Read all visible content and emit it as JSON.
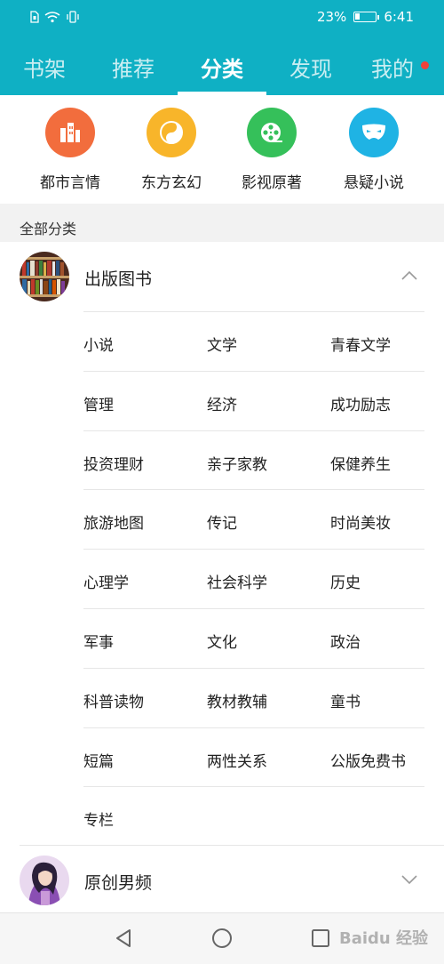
{
  "status_bar": {
    "battery_percent": "23%",
    "time": "6:41",
    "battery_level": 0.23,
    "icons": [
      "sim-icon",
      "wifi-icon",
      "vibrate-icon"
    ]
  },
  "tabs": [
    {
      "label": "书架"
    },
    {
      "label": "推荐"
    },
    {
      "label": "分类",
      "active": true
    },
    {
      "label": "发现"
    },
    {
      "label": "我的",
      "has_badge": true
    }
  ],
  "quick_categories": [
    {
      "label": "都市言情",
      "icon": "buildings-icon",
      "color": "#f26d3d"
    },
    {
      "label": "东方玄幻",
      "icon": "yin-yang-icon",
      "color": "#f8b52a"
    },
    {
      "label": "影视原著",
      "icon": "film-reel-icon",
      "color": "#35c05a"
    },
    {
      "label": "悬疑小说",
      "icon": "mask-icon",
      "color": "#1fb3e4"
    }
  ],
  "all_categories_label": "全部分类",
  "groups": [
    {
      "title": "出版图书",
      "expanded": true,
      "avatar": "bookshelf-image"
    },
    {
      "title": "原创男频",
      "expanded": false,
      "avatar": "character-image"
    }
  ],
  "subcategories": [
    [
      "小说",
      "文学",
      "青春文学"
    ],
    [
      "管理",
      "经济",
      "成功励志"
    ],
    [
      "投资理财",
      "亲子家教",
      "保健养生"
    ],
    [
      "旅游地图",
      "传记",
      "时尚美妆"
    ],
    [
      "心理学",
      "社会科学",
      "历史"
    ],
    [
      "军事",
      "文化",
      "政治"
    ],
    [
      "科普读物",
      "教材教辅",
      "童书"
    ],
    [
      "短篇",
      "两性关系",
      "公版免费书"
    ],
    [
      "专栏"
    ]
  ],
  "watermark": "Baidu 经验",
  "colors": {
    "accent": "#0fb0c4",
    "badge": "#f0413a"
  }
}
